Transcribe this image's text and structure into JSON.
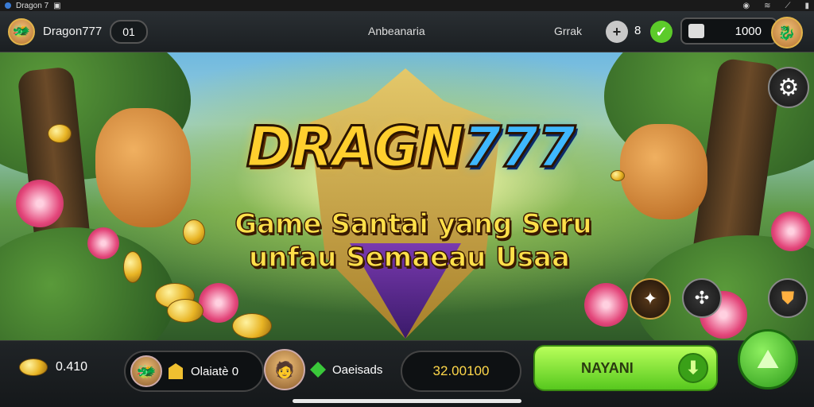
{
  "system_bar": {
    "app_title": "Dragon 7"
  },
  "top_bar": {
    "username": "Dragon777",
    "level": "01",
    "center_title": "Anbeanaria",
    "right_label": "Grrak",
    "counter_value": "8",
    "balance": "1000"
  },
  "hero": {
    "logo_main": "DRAGN",
    "logo_accent": "777",
    "tagline_line1": "Game Santai yang Seru",
    "tagline_line2": "unfau Semaeau Usaa"
  },
  "bottom_bar": {
    "coins_value": "0.410",
    "item1_value": "Olaiatè 0",
    "item2_label": "Oaeisads",
    "amount_value": "32.00100",
    "play_button_label": "NAYANI"
  },
  "icons": [
    "settings-gear-icon",
    "plus-icon",
    "check-icon",
    "camera-icon",
    "dragon-badge-icon",
    "ticket-icon",
    "shield-emblem-icon",
    "arrow-down-icon",
    "map-icon"
  ],
  "colors": {
    "gold": "#ffcf2e",
    "blue": "#3fb8ff",
    "green_button": "#6fd82a"
  }
}
